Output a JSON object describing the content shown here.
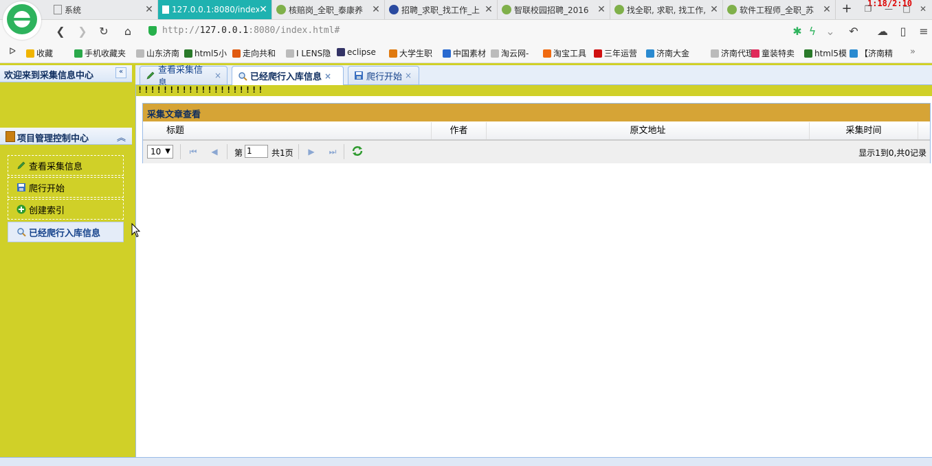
{
  "browser": {
    "tabs": [
      {
        "label": "系统",
        "active": false
      },
      {
        "label": "127.0.0.1:8080/index",
        "active": true
      },
      {
        "label": "核赔岗_全职_泰康养",
        "active": false
      },
      {
        "label": "招聘_求职_找工作_上",
        "active": false
      },
      {
        "label": "智联校园招聘_2016",
        "active": false
      },
      {
        "label": "找全职, 求职, 找工作,",
        "active": false
      },
      {
        "label": "软件工程师_全职_苏",
        "active": false
      }
    ],
    "clock": "1:18/2:10",
    "address": {
      "prefix": "http://",
      "host": "127.0.0.1",
      "rest": ":8080/index.html#"
    },
    "bookmarks": [
      {
        "label": "收藏",
        "color": "#f0b400"
      },
      {
        "label": "手机收藏夹",
        "color": "#2aa84a"
      },
      {
        "label": "山东济南",
        "color": "#bbbbbb"
      },
      {
        "label": "html5小",
        "color": "#2a7a2a"
      },
      {
        "label": "走向共和",
        "color": "#e05a10"
      },
      {
        "label": "I LENS隐",
        "color": "#bbbbbb"
      },
      {
        "label": "eclipse",
        "color": "#333366"
      },
      {
        "label": "大学生职",
        "color": "#e07a10"
      },
      {
        "label": "中国素材",
        "color": "#2a6ad0"
      },
      {
        "label": "淘云网-",
        "color": "#bbbbbb"
      },
      {
        "label": "淘宝工具",
        "color": "#f06a10"
      },
      {
        "label": "三年运营",
        "color": "#d01010"
      },
      {
        "label": "济南大金",
        "color": "#2a8ad0"
      },
      {
        "label": "济南代理",
        "color": "#bbbbbb"
      },
      {
        "label": "童装特卖",
        "color": "#e02a5a"
      },
      {
        "label": "html5模",
        "color": "#2a7a2a"
      },
      {
        "label": "【济南精",
        "color": "#2a8ad0"
      }
    ]
  },
  "app": {
    "west_title": "欢迎来到采集信息中心",
    "accordion_title": "项目管理控制中心",
    "nav_items": [
      {
        "label": "查看采集信息",
        "icon": "pencil-icon"
      },
      {
        "label": "爬行开始",
        "icon": "save-icon"
      },
      {
        "label": "创建索引",
        "icon": "add-icon"
      },
      {
        "label": "已经爬行入库信息",
        "icon": "search-icon"
      }
    ],
    "center_tabs": [
      {
        "label": "查看采集信息",
        "close": "×"
      },
      {
        "label": "已经爬行入库信息",
        "close": "×"
      },
      {
        "label": "爬行开始",
        "close": "×"
      }
    ],
    "notice": "!!!!!!!!!!!!!!!!!!!!",
    "panel_title": "采集文章查看",
    "columns": [
      "标题",
      "作者",
      "原文地址",
      "采集时间"
    ],
    "pager": {
      "page_size": "10",
      "page_label": "第",
      "page_value": "1",
      "total_label": "共1页",
      "info": "显示1到0,共0记录"
    }
  },
  "colors": {
    "layout_bg": "#d0d028",
    "panel_header": "#d6a436",
    "active_browser_tab": "#1fb2b0"
  }
}
